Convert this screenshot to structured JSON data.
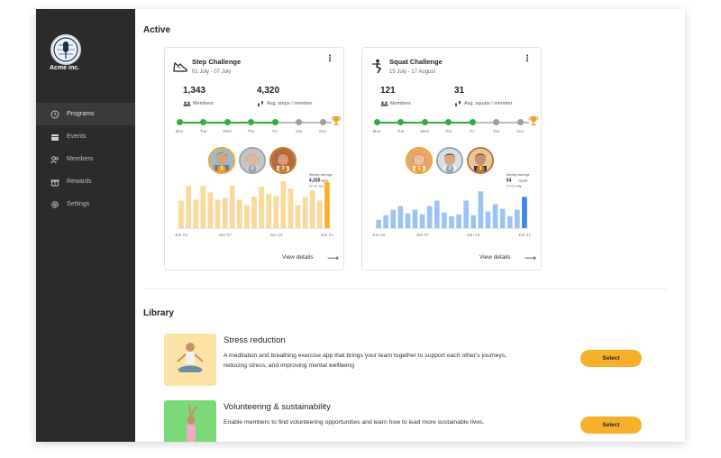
{
  "brand": {
    "name": "Acme inc."
  },
  "sidebar": {
    "items": [
      {
        "label": "Programs",
        "icon": "clock-icon",
        "active": true
      },
      {
        "label": "Events",
        "icon": "calendar-icon",
        "active": false
      },
      {
        "label": "Members",
        "icon": "members-icon",
        "active": false
      },
      {
        "label": "Rewards",
        "icon": "gift-icon",
        "active": false
      },
      {
        "label": "Settings",
        "icon": "gear-icon",
        "active": false
      }
    ]
  },
  "active": {
    "title": "Active",
    "cards": [
      {
        "title": "Step Challenge",
        "dates": "01 July - 07 July",
        "icon": "sneaker-icon",
        "members_value": "1,343",
        "members_label": "Members",
        "avg_value": "4,320",
        "avg_label": "Avg. steps / member",
        "days": [
          "Mon",
          "Tue",
          "Wed",
          "Thu",
          "Fri",
          "Sat",
          "Sun"
        ],
        "days_done": 5,
        "annotation": {
          "title": "Weekly average",
          "value": "4,320",
          "unit": "steps",
          "range": "17-21 Jun"
        },
        "bar_color": "#fbd89b",
        "highlight_color": "#f6b02c",
        "x_ticks": [
          "Jun 01",
          "Jun 07",
          "Jun 14",
          "Jun 21"
        ],
        "values": [
          60,
          92,
          62,
          92,
          78,
          62,
          66,
          92,
          62,
          50,
          68,
          90,
          74,
          70,
          102,
          86,
          50,
          68,
          82,
          60,
          100
        ],
        "ranks": [
          "1",
          "2",
          "3"
        ],
        "view_details": "View details"
      },
      {
        "title": "Squat Challenge",
        "dates": "15 July - 17 August",
        "icon": "squat-icon",
        "members_value": "121",
        "members_label": "Members",
        "avg_value": "31",
        "avg_label": "Avg. squats / member",
        "days": [
          "Mon",
          "Tue",
          "Wed",
          "Thu",
          "Fri",
          "Sat",
          "Sun"
        ],
        "days_done": 5,
        "annotation": {
          "title": "Weekly average",
          "value": "54",
          "unit": "squats",
          "range": "17-21 July"
        },
        "bar_color": "#9cc3f5",
        "highlight_color": "#3f86e6",
        "x_ticks": [
          "Jun 01",
          "Jun 07",
          "Jun 14",
          "Jun 21"
        ],
        "values": [
          18,
          28,
          40,
          48,
          32,
          40,
          30,
          48,
          60,
          34,
          26,
          30,
          60,
          28,
          80,
          36,
          52,
          42,
          26,
          40,
          68
        ],
        "ranks": [
          "1",
          "2",
          "3"
        ],
        "view_details": "View details"
      }
    ]
  },
  "library": {
    "title": "Library",
    "items": [
      {
        "title": "Stress reduction",
        "description": "A meditation and breathing exercise app that brings your team together to support each other's journeys, reducing stress, and improving mental wellbeing",
        "button": "Select",
        "thumb_bg": "#fbe3a6"
      },
      {
        "title": "Volunteering & sustainability",
        "description": "Enable members to find volunteering opportunities and learn how to lead more sustainable lives.",
        "button": "Select",
        "thumb_bg": "#7bd97a"
      }
    ]
  },
  "colors": {
    "accent": "#f6b02c",
    "progress_done": "#2fae3f",
    "progress_todo": "#9e9e9e",
    "sidebar": "#2b2b2b"
  }
}
